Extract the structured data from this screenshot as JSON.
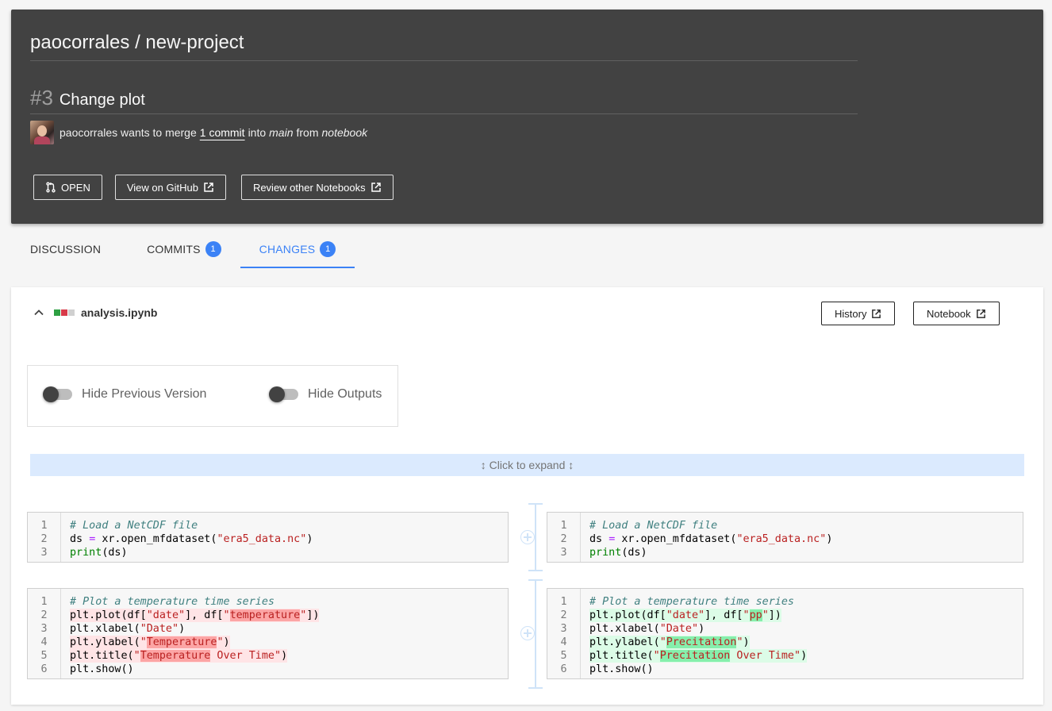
{
  "header": {
    "repo_title": "paocorrales / new-project",
    "pr_number": "#3",
    "pr_title": "Change plot",
    "merge_user": "paocorrales",
    "merge_text_1": "wants to merge",
    "commit_link": "1 commit",
    "merge_text_2": "into",
    "base_branch": "main",
    "merge_text_3": "from",
    "head_branch": "notebook",
    "buttons": {
      "status": "OPEN",
      "view_github": "View on GitHub",
      "review_other": "Review other Notebooks"
    }
  },
  "tabs": [
    {
      "label": "DISCUSSION",
      "badge": ""
    },
    {
      "label": "COMMITS",
      "badge": "1"
    },
    {
      "label": "CHANGES",
      "badge": "1"
    }
  ],
  "file": {
    "name": "analysis.ipynb",
    "history_label": "History",
    "notebook_label": "Notebook",
    "toggles": {
      "hide_previous": "Hide Previous Version",
      "hide_outputs": "Hide Outputs"
    },
    "expand_label": "↕ Click to expand ↕"
  },
  "colors": {
    "accent": "#3b82f6",
    "header_bg": "#424242",
    "deleted_bg": "#ffe4e6",
    "deleted_chunk": "#fca5a5",
    "added_bg": "#dcfce7",
    "added_chunk": "#86efac",
    "expand_bg": "#dbeafe"
  },
  "cells": {
    "cell1": {
      "line_numbers": [
        "1",
        "2",
        "3"
      ]
    },
    "cell2": {
      "line_numbers": [
        "1",
        "2",
        "3",
        "4",
        "5",
        "6"
      ]
    }
  },
  "code_text": {
    "c1_l1": "# Load a NetCDF file",
    "c1_l2_a": "ds",
    "c1_l2_op": "=",
    "c1_l2_b": "xr.open_mfdataset(",
    "c1_l2_str": "\"era5_data.nc\"",
    "c1_l2_c": ")",
    "c1_l3_kw": "print",
    "c1_l3_b": "(ds)",
    "c2_l1": "# Plot a temperature time series",
    "c2_l2_a": "plt.plot(df[",
    "c2_l2_s1": "\"date\"",
    "c2_l2_b": "], df[",
    "c2_l2_q1": "\"",
    "old_temperature": "temperature",
    "new_pp": "pp",
    "c2_l2_q2": "\"",
    "c2_l2_c": "])",
    "c2_l3_a": "plt.xlabel(",
    "c2_l3_s": "\"Date\"",
    "c2_l3_b": ")",
    "c2_l4_a": "plt.ylabel(",
    "c2_l4_q1": "\"",
    "old_Temperature": "Temperature",
    "new_Precitation": "Precitation",
    "c2_l4_q2": "\"",
    "c2_l4_b": ")",
    "c2_l5_a": "plt.title(",
    "c2_l5_q1": "\"",
    "c2_l5_rest": " Over Time\"",
    "c2_l5_b": ")",
    "c2_l6": "plt.show()"
  }
}
